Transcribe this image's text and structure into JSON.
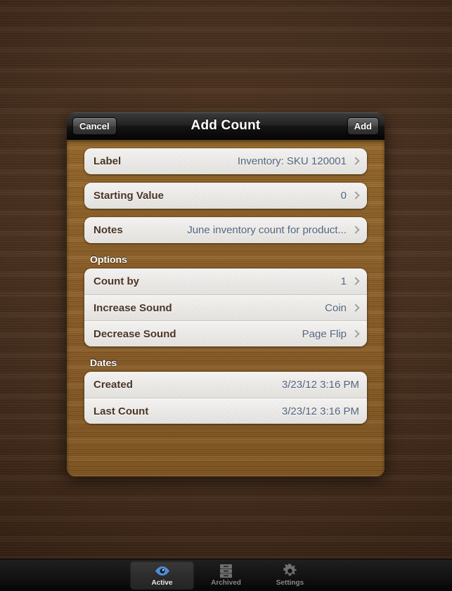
{
  "modal": {
    "title": "Add Count",
    "cancel_label": "Cancel",
    "add_label": "Add",
    "sections": [
      {
        "header": "",
        "rows": [
          {
            "label": "Label",
            "value": "Inventory: SKU 120001",
            "chevron": "chevron-right-icon"
          }
        ]
      },
      {
        "header": "",
        "rows": [
          {
            "label": "Starting Value",
            "value": "0",
            "chevron": "chevron-right-icon"
          }
        ]
      },
      {
        "header": "",
        "rows": [
          {
            "label": "Notes",
            "value": "June inventory count for product...",
            "chevron": "chevron-right-icon"
          }
        ]
      },
      {
        "header": "Options",
        "rows": [
          {
            "label": "Count by",
            "value": "1",
            "chevron": "chevron-right-icon"
          },
          {
            "label": "Increase Sound",
            "value": "Coin",
            "chevron": "chevron-right-icon"
          },
          {
            "label": "Decrease Sound",
            "value": "Page Flip",
            "chevron": "chevron-right-icon"
          }
        ]
      },
      {
        "header": "Dates",
        "rows": [
          {
            "label": "Created",
            "value": "3/23/12 3:16 PM",
            "chevron": ""
          },
          {
            "label": "Last Count",
            "value": "3/23/12 3:16 PM",
            "chevron": ""
          }
        ]
      }
    ]
  },
  "tabbar": {
    "tabs": [
      {
        "label": "Active",
        "icon": "eye-icon",
        "selected": true
      },
      {
        "label": "Archived",
        "icon": "file-cabinet-icon",
        "selected": false
      },
      {
        "label": "Settings",
        "icon": "gear-icon",
        "selected": false
      }
    ]
  },
  "colors": {
    "desk_wood": "#402a19",
    "modal_wood": "#8d6029",
    "cell_paper": "#efeeec",
    "label_text": "#4a3526",
    "value_text": "#53657f",
    "header_bar": "#151515",
    "tab_selected_text": "#f2f2f2",
    "tab_text": "#8a8a8a",
    "eye_icon_blue": "#4f8ed6"
  }
}
